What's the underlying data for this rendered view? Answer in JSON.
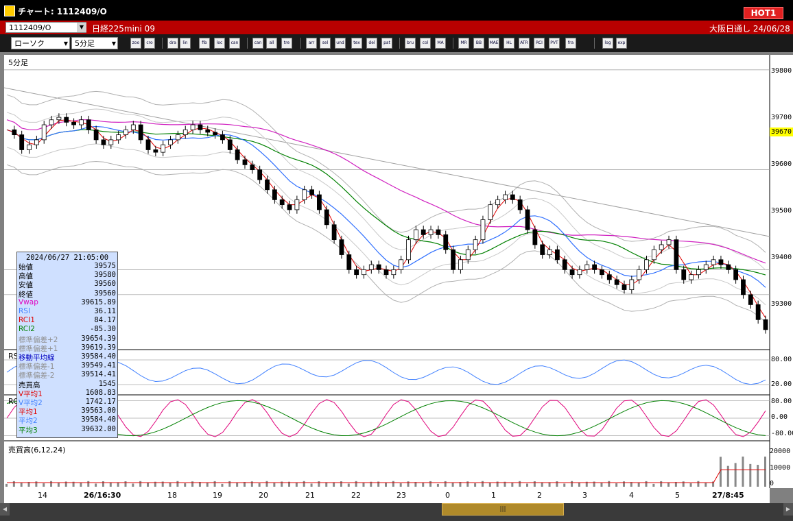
{
  "window": {
    "title": "チャート: 1112409/O",
    "hot_badge": "HOT1"
  },
  "symbol": {
    "code": "1112409/O",
    "name": "日経225mini 09",
    "session": "大阪日通し 24/06/28"
  },
  "toolbar": {
    "chart_type": "ローソク",
    "interval": "5分足",
    "buttons": [
      "zoom",
      "crosshair",
      "drawing",
      "line",
      "fibonacci",
      "lock",
      "candle-up",
      "candle-down",
      "all",
      "trend",
      "arrow",
      "select",
      "undo",
      "text",
      "delete",
      "pattern",
      "brush",
      "color",
      "MA",
      "MR",
      "BB",
      "MAE",
      "HL",
      "ATR",
      "RCI",
      "PVT",
      "frame",
      "log",
      "export"
    ]
  },
  "panels": {
    "main_label": "5分足",
    "rsi_label": "RSI",
    "rci_label": "RCI",
    "volume_label": "売買高(6,12,24)"
  },
  "price_axis": [
    "39800",
    "39700",
    "39600",
    "39500",
    "39400",
    "39300"
  ],
  "current_price": "39670",
  "rsi_axis": [
    "80.00",
    "20.00"
  ],
  "rci_axis": [
    "80.00",
    "0.00",
    "-80.00"
  ],
  "volume_axis": [
    "20000",
    "10000",
    "0"
  ],
  "time_axis": [
    "14",
    "26/16:30",
    "18",
    "19",
    "20",
    "21",
    "22",
    "23",
    "0",
    "1",
    "2",
    "3",
    "4",
    "5",
    "27/8:45"
  ],
  "info": {
    "datetime": "2024/06/27 21:05:00",
    "rows": [
      {
        "k": "始値",
        "v": "39575",
        "color": "#000000"
      },
      {
        "k": "高値",
        "v": "39580",
        "color": "#000000"
      },
      {
        "k": "安値",
        "v": "39560",
        "color": "#000000"
      },
      {
        "k": "終値",
        "v": "39560",
        "color": "#000000"
      },
      {
        "k": "Vwap",
        "v": "39615.89",
        "color": "#e000c0"
      },
      {
        "k": "RSI",
        "v": "36.11",
        "color": "#4080ff"
      },
      {
        "k": "RCI1",
        "v": "84.17",
        "color": "#e00000"
      },
      {
        "k": "RCI2",
        "v": "-85.30",
        "color": "#008000"
      },
      {
        "k": "標準偏差+2",
        "v": "39654.39",
        "color": "#909090"
      },
      {
        "k": "標準偏差+1",
        "v": "39619.39",
        "color": "#909090"
      },
      {
        "k": "移動平均線",
        "v": "39584.40",
        "color": "#0000c0"
      },
      {
        "k": "標準偏差-1",
        "v": "39549.41",
        "color": "#909090"
      },
      {
        "k": "標準偏差-2",
        "v": "39514.41",
        "color": "#909090"
      },
      {
        "k": "売買高",
        "v": "1545",
        "color": "#000000"
      },
      {
        "k": "V平均1",
        "v": "1608.83",
        "color": "#e00000"
      },
      {
        "k": "V平均2",
        "v": "1742.17",
        "color": "#4080ff"
      },
      {
        "k": "平均1",
        "v": "39563.00",
        "color": "#e00000"
      },
      {
        "k": "平均2",
        "v": "39584.40",
        "color": "#4080ff"
      },
      {
        "k": "平均3",
        "v": "39632.00",
        "color": "#008000"
      }
    ]
  },
  "chart_data": {
    "type": "candlestick",
    "title": "",
    "ylim": [
      39240,
      39830
    ],
    "grid": true,
    "closes": [
      39680,
      39670,
      39640,
      39650,
      39660,
      39690,
      39700,
      39705,
      39695,
      39690,
      39700,
      39680,
      39660,
      39650,
      39660,
      39670,
      39680,
      39690,
      39660,
      39640,
      39635,
      39650,
      39660,
      39670,
      39680,
      39690,
      39680,
      39675,
      39670,
      39660,
      39640,
      39620,
      39610,
      39600,
      39580,
      39560,
      39540,
      39530,
      39520,
      39540,
      39560,
      39550,
      39520,
      39490,
      39460,
      39430,
      39400,
      39390,
      39400,
      39410,
      39400,
      39390,
      39400,
      39420,
      39460,
      39480,
      39470,
      39480,
      39470,
      39440,
      39400,
      39420,
      39440,
      39460,
      39500,
      39530,
      39540,
      39550,
      39540,
      39520,
      39480,
      39450,
      39430,
      39440,
      39420,
      39400,
      39390,
      39400,
      39410,
      39400,
      39390,
      39380,
      39370,
      39360,
      39380,
      39400,
      39420,
      39440,
      39450,
      39460,
      39400,
      39380,
      39390,
      39400,
      39410,
      39420,
      39410,
      39400,
      39380,
      39350,
      39330,
      39300,
      39280
    ]
  }
}
